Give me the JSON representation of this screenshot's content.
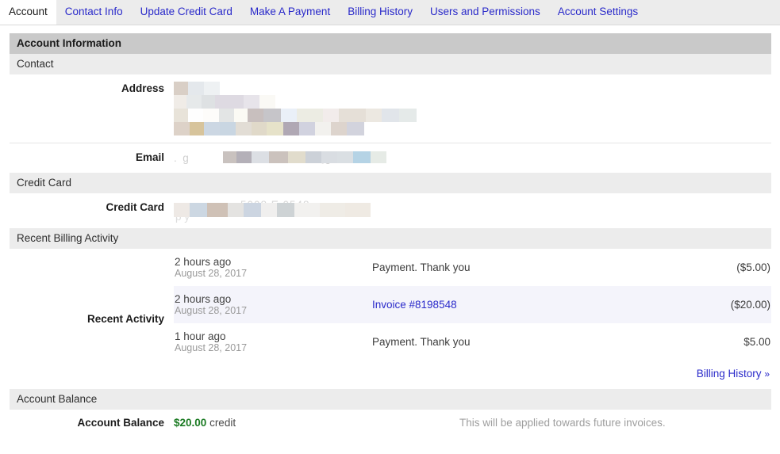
{
  "tabs": [
    {
      "label": "Account",
      "active": true
    },
    {
      "label": "Contact Info",
      "active": false
    },
    {
      "label": "Update Credit Card",
      "active": false
    },
    {
      "label": "Make A Payment",
      "active": false
    },
    {
      "label": "Billing History",
      "active": false
    },
    {
      "label": "Users and Permissions",
      "active": false
    },
    {
      "label": "Account Settings",
      "active": false
    }
  ],
  "panel": {
    "title": "Account Information",
    "sections": {
      "contact": {
        "heading": "Contact",
        "address_label": "Address",
        "address_value": "",
        "email_label": "Email",
        "email_value": ""
      },
      "credit_card": {
        "heading": "Credit Card",
        "label": "Credit Card",
        "value": ""
      },
      "recent_billing": {
        "heading": "Recent Billing Activity",
        "label": "Recent Activity",
        "rows": [
          {
            "relative": "2 hours ago",
            "date": "August 28, 2017",
            "description": "Payment. Thank you",
            "is_link": false,
            "amount": "($5.00)",
            "highlighted": false
          },
          {
            "relative": "2 hours ago",
            "date": "August 28, 2017",
            "description": "Invoice #8198548",
            "is_link": true,
            "amount": "($20.00)",
            "highlighted": true
          },
          {
            "relative": "1 hour ago",
            "date": "August 28, 2017",
            "description": "Payment. Thank you",
            "is_link": false,
            "amount": "$5.00",
            "highlighted": false
          }
        ],
        "history_link": "Billing History",
        "history_chevron": "»"
      },
      "account_balance": {
        "heading": "Account Balance",
        "label": "Account Balance",
        "amount": "$20.00",
        "unit": "credit",
        "note": "This will be applied towards future invoices."
      }
    }
  },
  "colors": {
    "link": "#2a2aca",
    "title_bar": "#c9c9c9",
    "sub_bar": "#ececec",
    "row_highlight": "#f4f4fb",
    "credit_green": "#1a7a22",
    "muted": "#9e9e9e"
  }
}
